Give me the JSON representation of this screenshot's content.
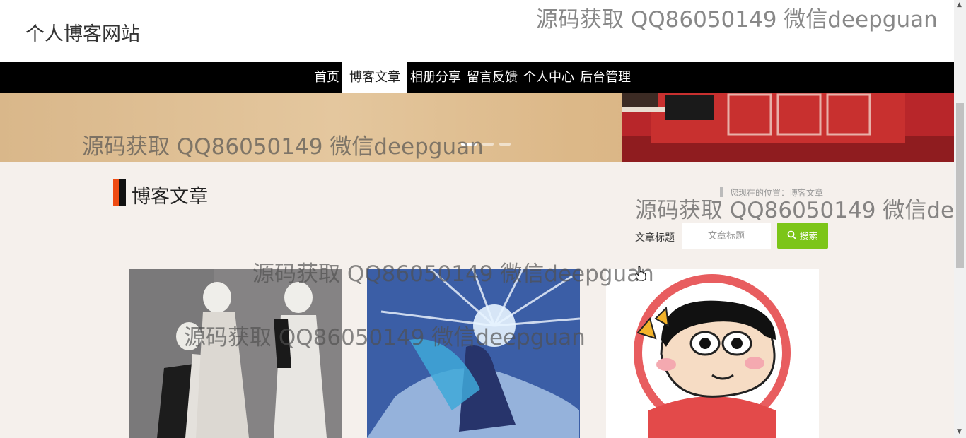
{
  "header": {
    "site_title": "个人博客网站"
  },
  "nav": {
    "items": [
      {
        "label": "首页",
        "active": false
      },
      {
        "label": "博客文章",
        "active": true
      },
      {
        "label": "相册分享",
        "active": false
      },
      {
        "label": "留言反馈",
        "active": false
      },
      {
        "label": "个人中心",
        "active": false
      },
      {
        "label": "后台管理",
        "active": false
      }
    ]
  },
  "banner": {
    "slides": 3,
    "active_slide": 1
  },
  "section": {
    "title": "博客文章",
    "breadcrumb": "您现在的位置：博客文章"
  },
  "search": {
    "label": "文章标题",
    "placeholder": "文章标题",
    "button_label": "搜索"
  },
  "cards": [
    {
      "image": "anime-two-white-haired-men"
    },
    {
      "image": "anime-blue-haired-girl-ice"
    },
    {
      "image": "crayon-shinchan-avatar"
    }
  ],
  "watermark": "源码获取 QQ86050149 微信deepguan",
  "colors": {
    "nav_bg": "#000000",
    "accent": "#ef4b12",
    "search_button": "#7cc518",
    "page_bg": "#f5f0ec"
  }
}
